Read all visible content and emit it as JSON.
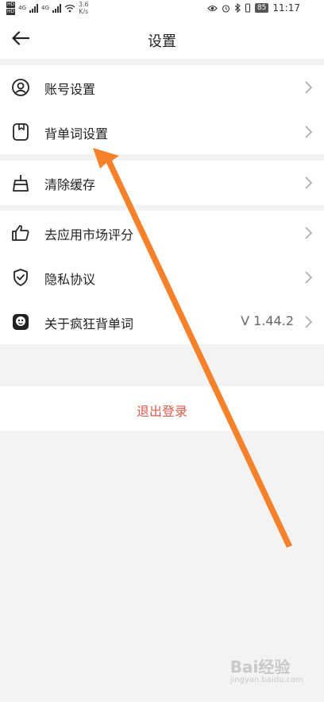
{
  "status_bar": {
    "hd_top": "HD",
    "hd_bottom": "HD",
    "sig1": "4G",
    "sig2": "4G",
    "speed_value": "3.6",
    "speed_unit": "K/s",
    "battery": "85",
    "time": "11:17"
  },
  "header": {
    "title": "设置"
  },
  "groups": {
    "account": {
      "label": "账号设置"
    },
    "vocab": {
      "label": "背单词设置"
    },
    "cache": {
      "label": "清除缓存"
    },
    "rate": {
      "label": "去应用市场评分"
    },
    "privacy": {
      "label": "隐私协议"
    },
    "about": {
      "label": "关于疯狂背单词",
      "value": "V 1.44.2"
    }
  },
  "logout": {
    "label": "退出登录"
  },
  "watermark": {
    "text": "Bai经验",
    "sub": "jingyan.baidu.com"
  },
  "colors": {
    "background": "#f3f3f3",
    "logout_text": "#e05a4a",
    "arrow": "#f5822a"
  },
  "icons": {
    "back": "arrow-left-icon",
    "account": "user-circle-icon",
    "vocab": "bookmark-box-icon",
    "cache": "broom-icon",
    "rate": "thumbs-up-icon",
    "privacy": "shield-check-icon",
    "about": "app-logo-icon",
    "chevron": "chevron-right-icon"
  }
}
